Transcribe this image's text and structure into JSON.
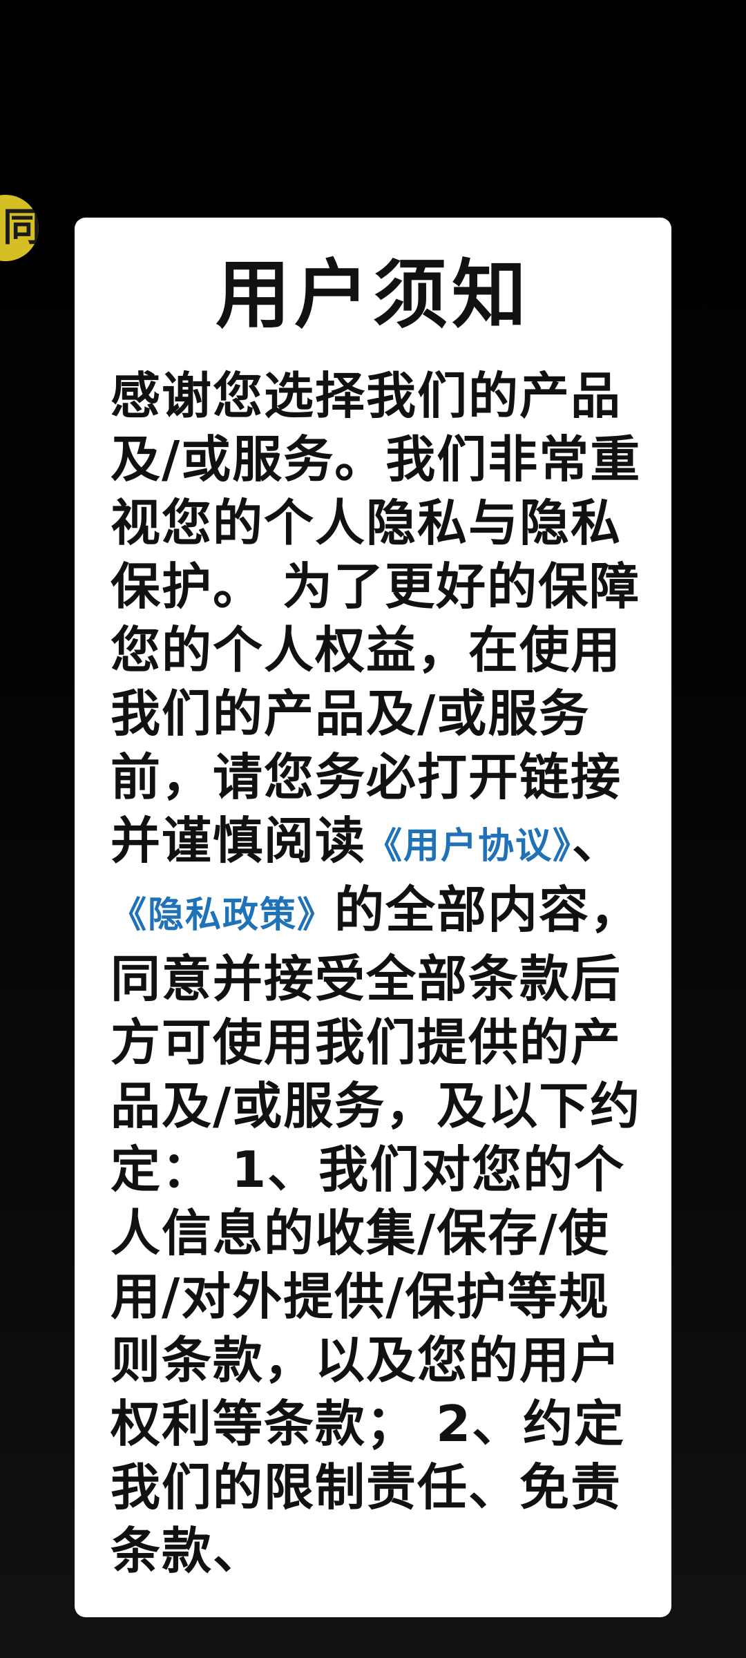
{
  "background": {
    "badge_color": "#d6bf25",
    "badge_glyph": "同"
  },
  "dialog": {
    "title": "用户须知",
    "body": {
      "text_before_links": "感谢您选择我们的产品及/或服务。我们非常重视您的个人隐私与隐私保护。 为了更好的保障您的个人权益，在使用我们的产品及/或服务前，请您务必打开链接并谨慎阅读",
      "user_agreement_link": "《用户协议》",
      "separator": "、",
      "privacy_policy_link": "《隐私政策》",
      "text_after_links": "的全部内容，同意并接受全部条款后方可使用我们提供的产品及/或服务，及以下约定： 1、我们对您的个人信息的收集/保存/使用/对外提供/保护等规则条款，以及您的用户权利等条款； 2、约定我们的限制责任、免责条款、"
    },
    "link_color": "#1f72b8"
  }
}
